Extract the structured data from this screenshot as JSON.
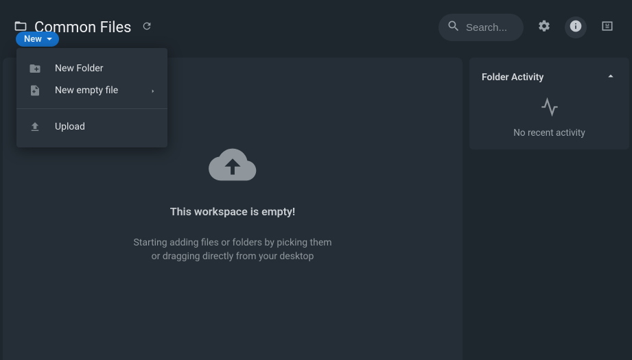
{
  "header": {
    "title": "Common Files",
    "search_placeholder": "Search..."
  },
  "new_button": {
    "label": "New"
  },
  "menu": {
    "items": [
      {
        "label": "New Folder",
        "has_submenu": false
      },
      {
        "label": "New empty file",
        "has_submenu": true
      }
    ],
    "upload_label": "Upload"
  },
  "empty_state": {
    "title": "This workspace is empty!",
    "subtitle": "Starting adding files or folders by picking them or dragging directly from your desktop"
  },
  "side_panel": {
    "title": "Folder Activity",
    "no_activity": "No recent activity"
  }
}
